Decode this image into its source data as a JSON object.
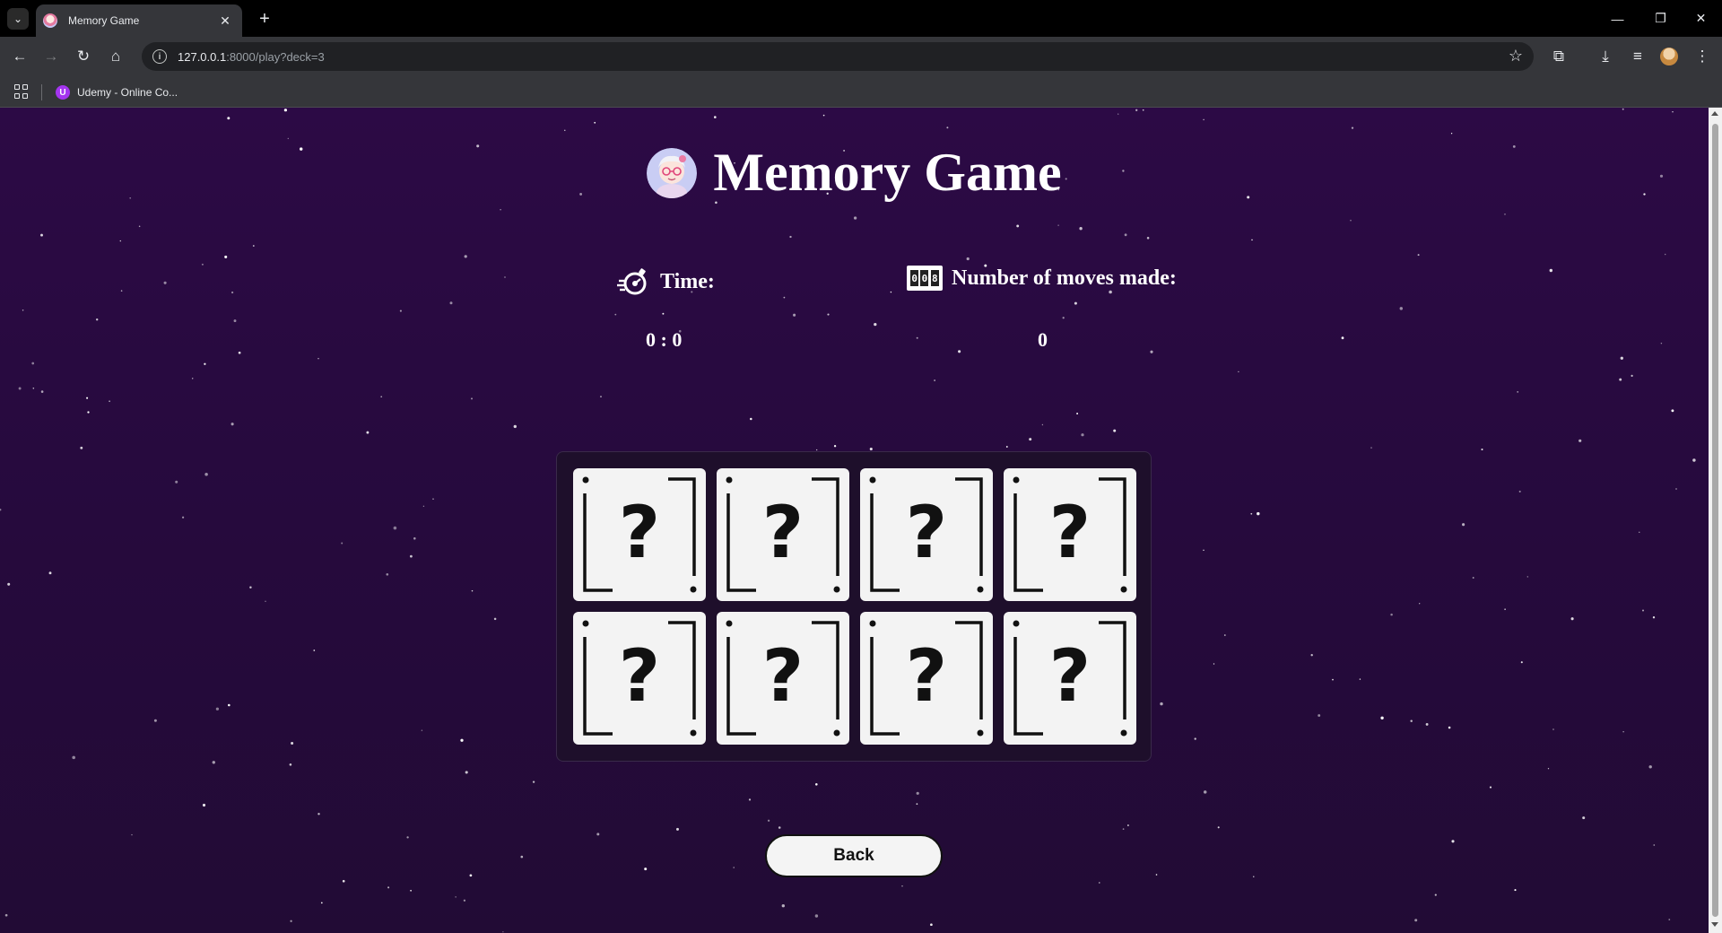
{
  "browser": {
    "tab_title": "Memory Game",
    "url_host": "127.0.0.1",
    "url_path": ":8000/play?deck=3",
    "bookmark_label": "Udemy - Online Co..."
  },
  "page": {
    "title": "Memory Game",
    "time_label": "Time:",
    "time_value": "0 : 0",
    "moves_label": "Number of moves made:",
    "moves_value": "0",
    "counter_digits": "008",
    "back_label": "Back",
    "card_symbol": "?",
    "cards": [
      {
        "state": "face-down"
      },
      {
        "state": "face-down"
      },
      {
        "state": "face-down"
      },
      {
        "state": "face-down"
      },
      {
        "state": "face-down"
      },
      {
        "state": "face-down"
      },
      {
        "state": "face-down"
      },
      {
        "state": "face-down"
      }
    ]
  },
  "colors": {
    "background_top": "#2c0a45",
    "background_bottom": "#220b35",
    "card_face": "#f3f3f3",
    "text": "#ffffff"
  }
}
